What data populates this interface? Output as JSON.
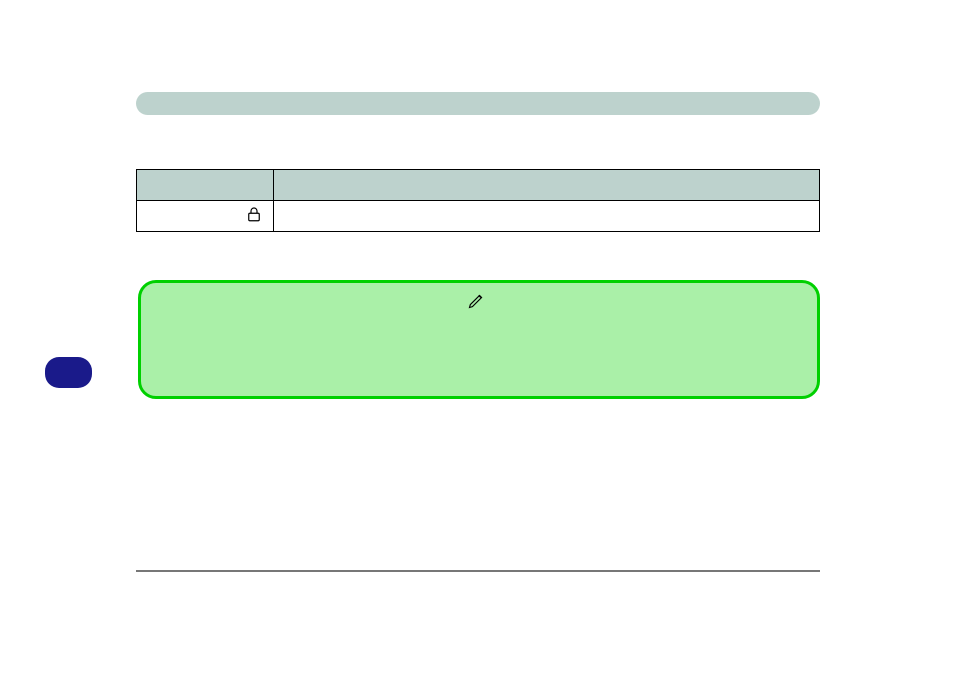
{
  "pill": {
    "bg": "#bdd2cd"
  },
  "table": {
    "header_bg": "#bdd2cd",
    "cols": 2,
    "rows": 1
  },
  "icons": {
    "lock": "lock-icon",
    "pen": "pen-icon"
  },
  "card": {
    "border": "#00d000",
    "bg": "#aaf0a8"
  },
  "badge": {
    "bg": "#1a1a8a"
  },
  "divider": {
    "color": "#777777"
  }
}
